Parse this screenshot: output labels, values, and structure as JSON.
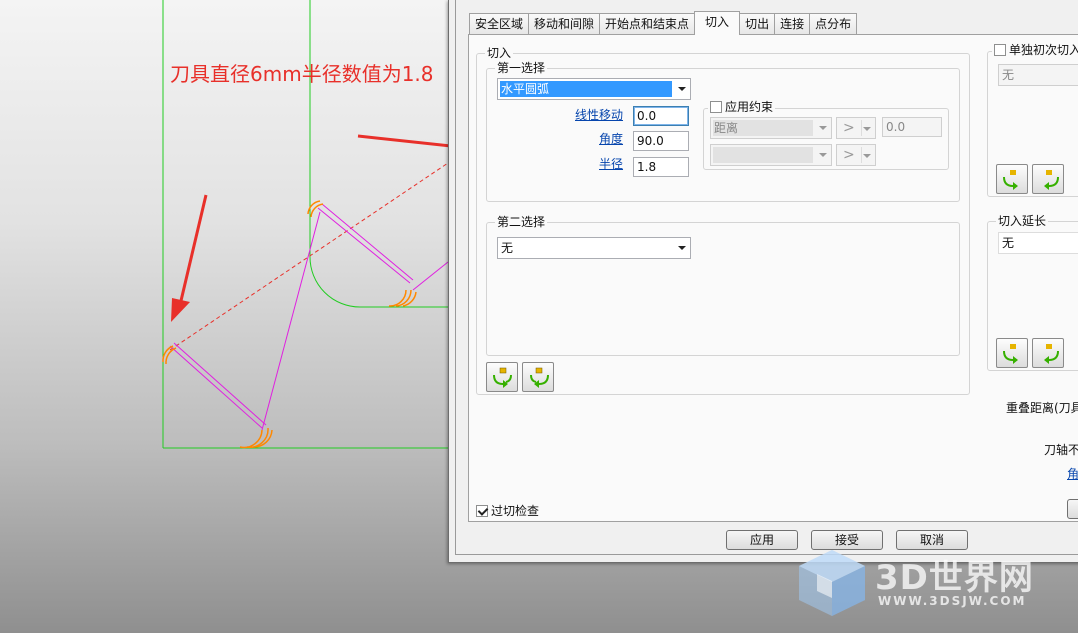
{
  "annotation": {
    "text": "刀具直径6mm半径数值为1.8",
    "color": "#e8302a"
  },
  "tabs": [
    {
      "label": "安全区域",
      "active": false
    },
    {
      "label": "移动和间隙",
      "active": false
    },
    {
      "label": "开始点和结束点",
      "active": false
    },
    {
      "label": "切入",
      "active": true
    },
    {
      "label": "切出",
      "active": false
    },
    {
      "label": "连接",
      "active": false
    },
    {
      "label": "点分布",
      "active": false
    }
  ],
  "cut_in": {
    "group_label": "切入",
    "first_choice": {
      "group_label": "第一选择",
      "type_value": "水平圆弧",
      "linear_move_label": "线性移动",
      "linear_move_value": "0.0",
      "angle_label": "角度",
      "angle_value": "90.0",
      "radius_label": "半径",
      "radius_value": "1.8",
      "constraint": {
        "checkbox_label": "应用约束",
        "checked": false,
        "row1_select": "距离",
        "row1_op": ">",
        "row1_value": "0.0",
        "row2_select": "",
        "row2_op": ">"
      }
    },
    "second_choice": {
      "group_label": "第二选择",
      "type_value": "无"
    }
  },
  "right_panel": {
    "separate_first_label": "单独初次切入",
    "separate_first_checked": false,
    "separate_first_select": "无",
    "extension_label": "切入延长",
    "extension_select": "无",
    "overlap_label": "重叠距离(刀具",
    "axis_label": "刀轴不",
    "angle_link": "角"
  },
  "overcut_check": {
    "label": "过切检查",
    "checked": true
  },
  "buttons": {
    "apply": "应用",
    "accept": "接受",
    "cancel": "取消"
  },
  "watermark": {
    "title": "3D世界网",
    "url": "WWW.3DSJW.COM"
  },
  "colors": {
    "toolpath": "#e020e0",
    "boundary": "#22cc22",
    "arc": "#ff8800",
    "arrow": "#e8302a"
  }
}
